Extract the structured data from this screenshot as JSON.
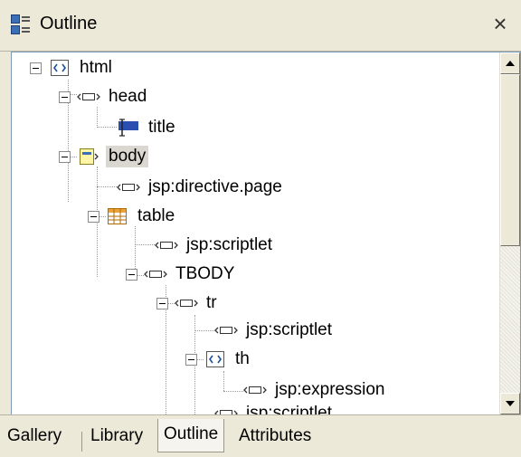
{
  "panel": {
    "title": "Outline",
    "close_label": "×"
  },
  "tree": [
    {
      "label": "html",
      "icon": "html-tag-icon",
      "expander": true
    },
    {
      "label": "head",
      "icon": "element-tag-icon",
      "expander": true
    },
    {
      "label": "title",
      "icon": "title-element-icon",
      "expander": false
    },
    {
      "label": "body",
      "icon": "body-element-icon",
      "expander": true,
      "selected": true
    },
    {
      "label": "jsp:directive.page",
      "icon": "element-tag-icon",
      "expander": false
    },
    {
      "label": "table",
      "icon": "table-grid-icon",
      "expander": true
    },
    {
      "label": "jsp:scriptlet",
      "icon": "element-tag-icon",
      "expander": false
    },
    {
      "label": "TBODY",
      "icon": "element-tag-icon",
      "expander": true
    },
    {
      "label": "tr",
      "icon": "element-tag-icon",
      "expander": true
    },
    {
      "label": "jsp:scriptlet",
      "icon": "element-tag-icon",
      "expander": false
    },
    {
      "label": "th",
      "icon": "html-tag-icon",
      "expander": true
    },
    {
      "label": "jsp:expression",
      "icon": "element-tag-icon",
      "expander": false
    },
    {
      "label": "jsp:scriptlet",
      "icon": "element-tag-icon",
      "expander": false
    }
  ],
  "tabs": [
    {
      "label": "Gallery"
    },
    {
      "label": "Library"
    },
    {
      "label": "Outline",
      "active": true
    },
    {
      "label": "Attributes"
    }
  ]
}
